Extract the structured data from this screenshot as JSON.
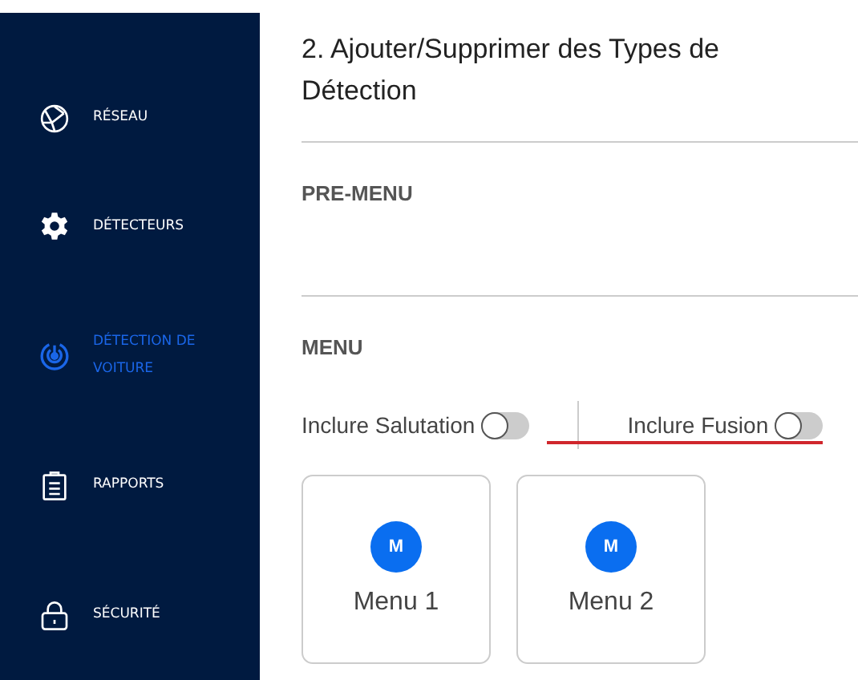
{
  "sidebar": {
    "items": [
      {
        "label": "RÉSEAU",
        "selected": false
      },
      {
        "label": "DÉTECTEURS",
        "selected": false
      },
      {
        "label": "DÉTECTION DE VOITURE",
        "selected": true
      },
      {
        "label": "RAPPORTS",
        "selected": false
      },
      {
        "label": "SÉCURITÉ",
        "selected": false
      }
    ]
  },
  "header": {
    "title": "2. Ajouter/Supprimer des Types de Détection"
  },
  "sections": [
    {
      "heading": "PRE-MENU"
    },
    {
      "heading": "MENU"
    }
  ],
  "toggles": [
    {
      "label": "Inclure Salutation",
      "on": false,
      "struck": false
    },
    {
      "label": "Inclure Fusion",
      "on": false,
      "struck": true
    }
  ],
  "menus": [
    {
      "badge": "M",
      "label": "Menu 1"
    },
    {
      "badge": "M",
      "label": "Menu 2"
    }
  ]
}
